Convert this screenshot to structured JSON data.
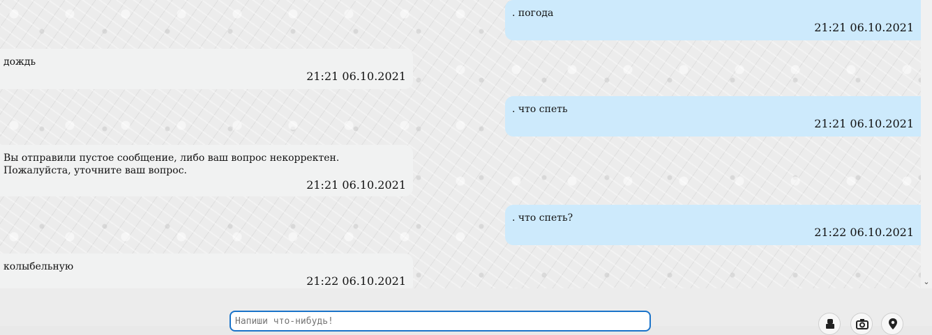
{
  "messages": [
    {
      "side": "user",
      "text": ". погода",
      "time": "21:21 06.10.2021"
    },
    {
      "side": "bot",
      "text": "дождь",
      "time": "21:21 06.10.2021"
    },
    {
      "side": "user",
      "text": ". что спеть",
      "time": "21:21 06.10.2021"
    },
    {
      "side": "bot",
      "text": "Вы отправили пустое сообщение, либо ваш вопрос некорректен. Пожалуйста, уточните ваш вопрос.",
      "time": "21:21 06.10.2021"
    },
    {
      "side": "user",
      "text": ". что спеть?",
      "time": "21:22 06.10.2021"
    },
    {
      "side": "bot",
      "text": "колыбельную",
      "time": "21:22 06.10.2021"
    }
  ],
  "composer": {
    "placeholder": "Напиши что-нибудь!"
  },
  "icons": {
    "scroll_down": "chevron-down-icon",
    "voice": "robot-icon",
    "camera": "camera-icon",
    "location": "map-pin-icon"
  },
  "colors": {
    "user_bubble": "#cdeafc",
    "bot_bubble": "#f1f2f2",
    "input_border": "#1a73c9"
  }
}
